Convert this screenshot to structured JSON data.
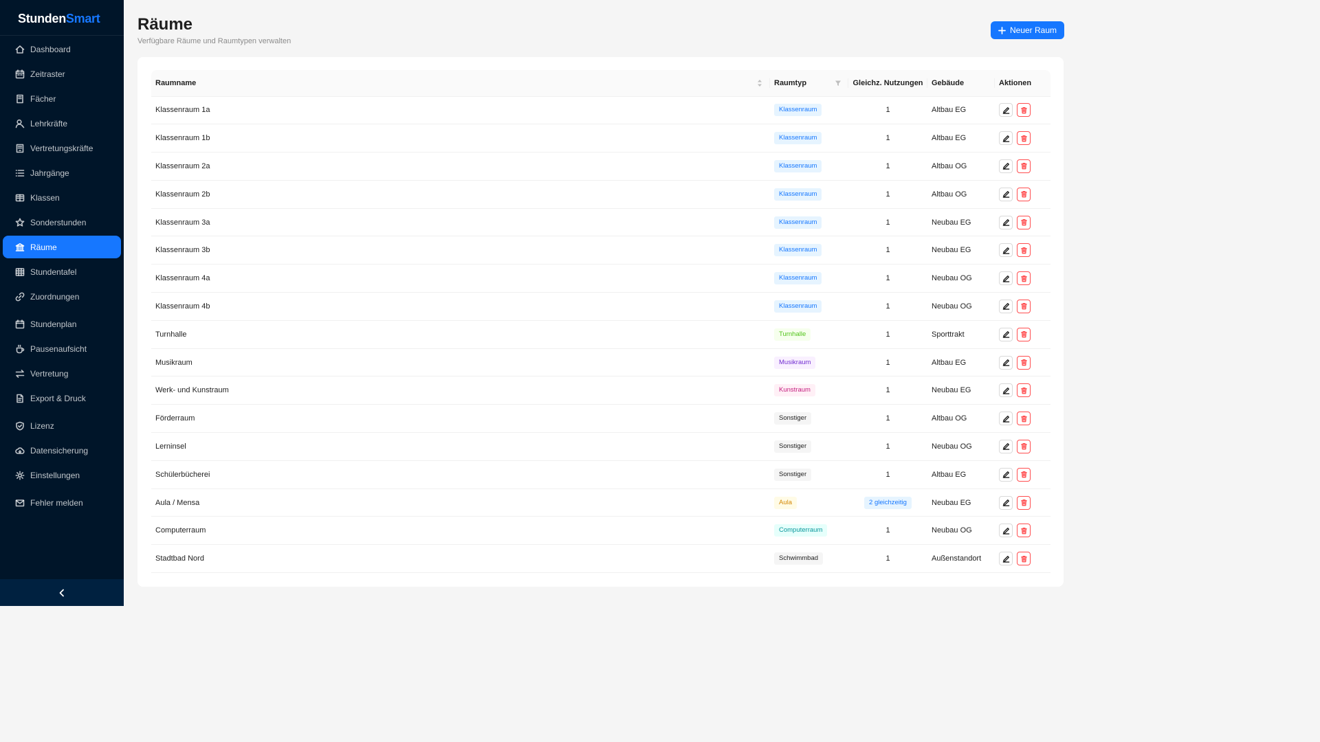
{
  "app": {
    "name_part1": "Stunden",
    "name_part2": "Smart"
  },
  "colors": {
    "sidebar_bg": "#001529",
    "accent": "#1677ff",
    "danger": "#ff4d4f"
  },
  "sidebar": {
    "items": [
      {
        "label": "Dashboard",
        "icon": "home-icon",
        "active": false
      },
      {
        "label": "Zeitraster",
        "icon": "calendar-icon",
        "active": false
      },
      {
        "label": "Fächer",
        "icon": "book-icon",
        "active": false
      },
      {
        "label": "Lehrkräfte",
        "icon": "user-icon",
        "active": false
      },
      {
        "label": "Vertretungskräfte",
        "icon": "id-card-icon",
        "active": false
      },
      {
        "label": "Jahrgänge",
        "icon": "list-icon",
        "active": false
      },
      {
        "label": "Klassen",
        "icon": "reader-icon",
        "active": false
      },
      {
        "label": "Sonderstunden",
        "icon": "star-icon",
        "active": false
      },
      {
        "label": "Räume",
        "icon": "bank-icon",
        "active": true
      },
      {
        "label": "Stundentafel",
        "icon": "table-icon",
        "active": false
      },
      {
        "label": "Zuordnungen",
        "icon": "link-icon",
        "active": false
      },
      {
        "label": "Stundenplan",
        "icon": "schedule-icon",
        "active": false
      },
      {
        "label": "Pausenaufsicht",
        "icon": "coffee-icon",
        "active": false
      },
      {
        "label": "Vertretung",
        "icon": "swap-icon",
        "active": false
      },
      {
        "label": "Export & Druck",
        "icon": "file-pdf-icon",
        "active": false
      },
      {
        "label": "Lizenz",
        "icon": "safety-icon",
        "active": false
      },
      {
        "label": "Datensicherung",
        "icon": "cloud-icon",
        "active": false
      },
      {
        "label": "Einstellungen",
        "icon": "gear-icon",
        "active": false
      },
      {
        "label": "Fehler melden",
        "icon": "mail-icon",
        "active": false
      }
    ],
    "collapse_icon": "chevron-left-icon"
  },
  "header": {
    "title": "Räume",
    "subtitle": "Verfügbare Räume und Raumtypen verwalten",
    "new_button_label": "Neuer Raum",
    "new_button_icon": "plus-icon"
  },
  "table": {
    "columns": {
      "name": "Raumname",
      "type": "Raumtyp",
      "concurrent": "Gleichz. Nutzungen",
      "building": "Gebäude",
      "actions": "Aktionen"
    },
    "rows": [
      {
        "name": "Klassenraum 1a",
        "type": "Klassenraum",
        "type_color": "blue",
        "concurrent": "1",
        "concurrent_tag": false,
        "building": "Altbau EG"
      },
      {
        "name": "Klassenraum 1b",
        "type": "Klassenraum",
        "type_color": "blue",
        "concurrent": "1",
        "concurrent_tag": false,
        "building": "Altbau EG"
      },
      {
        "name": "Klassenraum 2a",
        "type": "Klassenraum",
        "type_color": "blue",
        "concurrent": "1",
        "concurrent_tag": false,
        "building": "Altbau OG"
      },
      {
        "name": "Klassenraum 2b",
        "type": "Klassenraum",
        "type_color": "blue",
        "concurrent": "1",
        "concurrent_tag": false,
        "building": "Altbau OG"
      },
      {
        "name": "Klassenraum 3a",
        "type": "Klassenraum",
        "type_color": "blue",
        "concurrent": "1",
        "concurrent_tag": false,
        "building": "Neubau EG"
      },
      {
        "name": "Klassenraum 3b",
        "type": "Klassenraum",
        "type_color": "blue",
        "concurrent": "1",
        "concurrent_tag": false,
        "building": "Neubau EG"
      },
      {
        "name": "Klassenraum 4a",
        "type": "Klassenraum",
        "type_color": "blue",
        "concurrent": "1",
        "concurrent_tag": false,
        "building": "Neubau OG"
      },
      {
        "name": "Klassenraum 4b",
        "type": "Klassenraum",
        "type_color": "blue",
        "concurrent": "1",
        "concurrent_tag": false,
        "building": "Neubau OG"
      },
      {
        "name": "Turnhalle",
        "type": "Turnhalle",
        "type_color": "green",
        "concurrent": "1",
        "concurrent_tag": false,
        "building": "Sporttrakt"
      },
      {
        "name": "Musikraum",
        "type": "Musikraum",
        "type_color": "purple",
        "concurrent": "1",
        "concurrent_tag": false,
        "building": "Altbau EG"
      },
      {
        "name": "Werk- und Kunstraum",
        "type": "Kunstraum",
        "type_color": "magenta",
        "concurrent": "1",
        "concurrent_tag": false,
        "building": "Neubau EG"
      },
      {
        "name": "Förderraum",
        "type": "Sonstiger",
        "type_color": "default",
        "concurrent": "1",
        "concurrent_tag": false,
        "building": "Altbau OG"
      },
      {
        "name": "Lerninsel",
        "type": "Sonstiger",
        "type_color": "default",
        "concurrent": "1",
        "concurrent_tag": false,
        "building": "Neubau OG"
      },
      {
        "name": "Schülerbücherei",
        "type": "Sonstiger",
        "type_color": "default",
        "concurrent": "1",
        "concurrent_tag": false,
        "building": "Altbau EG"
      },
      {
        "name": "Aula / Mensa",
        "type": "Aula",
        "type_color": "gold",
        "concurrent": "2 gleichzeitig",
        "concurrent_tag": true,
        "building": "Neubau EG"
      },
      {
        "name": "Computerraum",
        "type": "Computerraum",
        "type_color": "cyan",
        "concurrent": "1",
        "concurrent_tag": false,
        "building": "Neubau OG"
      },
      {
        "name": "Stadtbad Nord",
        "type": "Schwimmbad",
        "type_color": "default",
        "concurrent": "1",
        "concurrent_tag": false,
        "building": "Außenstandort"
      }
    ]
  }
}
